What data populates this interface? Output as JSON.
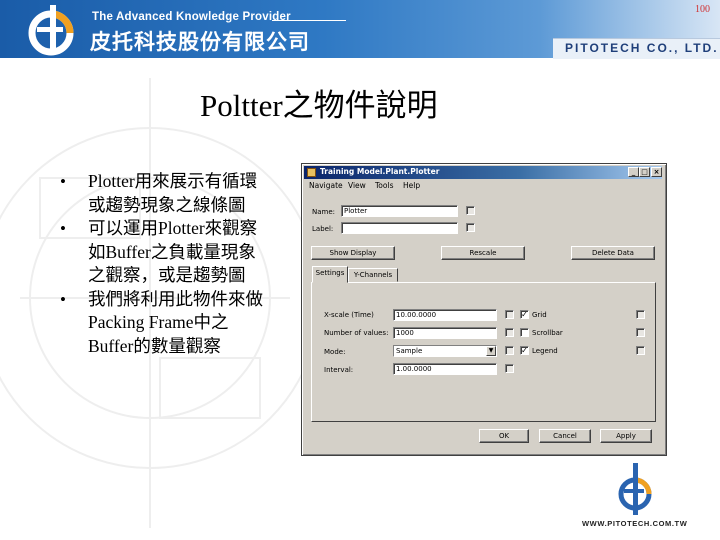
{
  "header": {
    "tagline": "The Advanced Knowledge Provider",
    "company_cn": "皮托科技股份有限公司",
    "company_en": "PITOTECH CO., LTD.",
    "page_number": "100",
    "brand_color": "#1a5ca8"
  },
  "slide": {
    "title": "Poltter之物件說明",
    "bullets": [
      "Plotter用來展示有循環或趨勢現象之線條圖",
      "可以運用Plotter來觀察如Buffer之負載量現象之觀察，或是趨勢圖",
      "我們將利用此物件來做Packing Frame中之Buffer的數量觀察"
    ]
  },
  "dialog": {
    "title": "Training Model.Plant.Plotter",
    "controls": {
      "minimize": "_",
      "maximize": "□",
      "close": "×"
    },
    "menu": [
      "Navigate",
      "View",
      "Tools",
      "Help"
    ],
    "name_label": "Name:",
    "name_value": "Plotter",
    "label_label": "Label:",
    "label_value": "",
    "buttons": {
      "show_display": "Show Display",
      "rescale": "Rescale",
      "delete_data": "Delete Data",
      "ok": "OK",
      "cancel": "Cancel",
      "apply": "Apply"
    },
    "tabs": [
      "Settings",
      "Y-Channels"
    ],
    "settings": {
      "xscale_label": "X-scale (Time)",
      "xscale_value": "10.00.0000",
      "num_values_label": "Number of values:",
      "num_values_value": "1000",
      "mode_label": "Mode:",
      "mode_value": "Sample",
      "interval_label": "Interval:",
      "interval_value": "1.00.0000",
      "grid_label": "Grid",
      "scrollbar_label": "Scrollbar",
      "legend_label": "Legend",
      "grid_checked": "✓",
      "scrollbar_checked": "",
      "legend_checked": "✓"
    }
  },
  "footer": {
    "website": "WWW.PITOTECH.COM.TW"
  }
}
